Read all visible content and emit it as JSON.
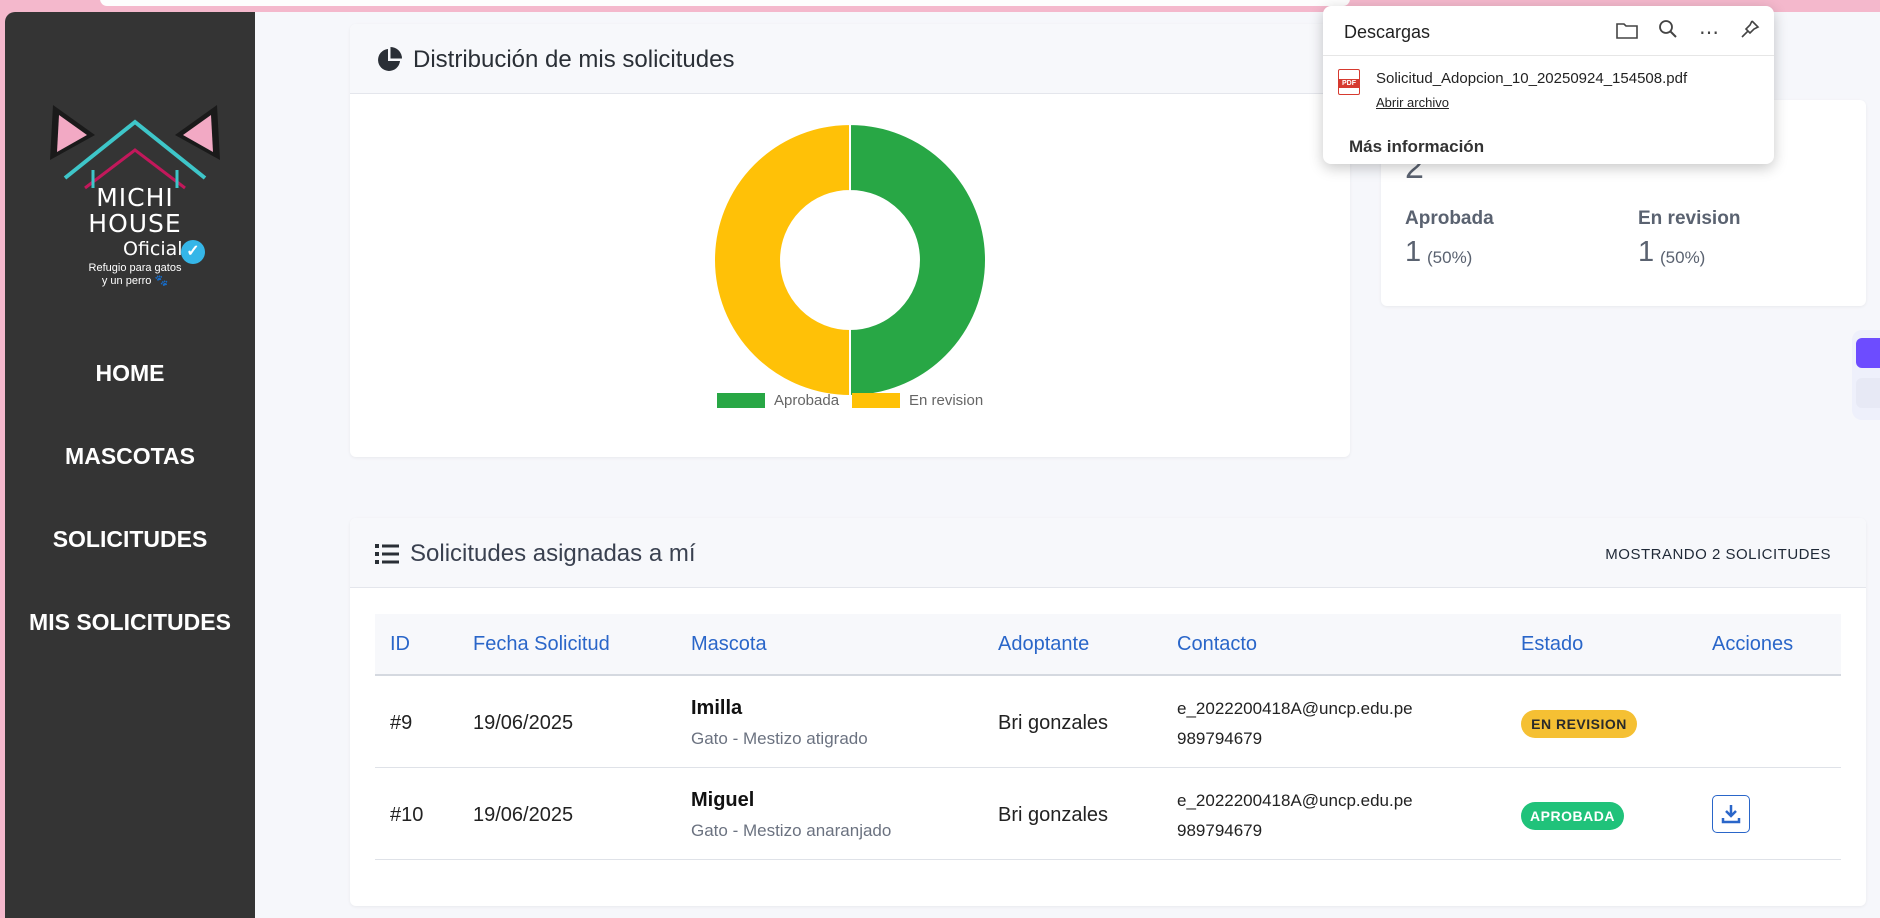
{
  "sidebar": {
    "logo": {
      "line1": "MICHI",
      "line2": "HOUSE",
      "oficial": "Oficial",
      "tagline1": "Refugio para gatos",
      "tagline2": "y un perro 🐾"
    },
    "nav": [
      "HOME",
      "MASCOTAS",
      "SOLICITUDES",
      "MIS SOLICITUDES"
    ]
  },
  "distribution": {
    "title": "Distribución de mis solicitudes"
  },
  "chart_data": {
    "type": "pie",
    "donut": true,
    "categories": [
      "Aprobada",
      "En revision"
    ],
    "values": [
      1,
      1
    ],
    "colors": [
      "#28a745",
      "#ffc107"
    ],
    "legend": "bottom"
  },
  "stats": {
    "total_value": "2",
    "items": [
      {
        "label": "Aprobada",
        "value": "1",
        "pct": "(50%)"
      },
      {
        "label": "En revision",
        "value": "1",
        "pct": "(50%)"
      }
    ]
  },
  "assigned": {
    "title": "Solicitudes asignadas a mí",
    "count_label": "MOSTRANDO 2 SOLICITUDES",
    "headers": [
      "ID",
      "Fecha Solicitud",
      "Mascota",
      "Adoptante",
      "Contacto",
      "Estado",
      "Acciones"
    ],
    "rows": [
      {
        "id": "#9",
        "fecha": "19/06/2025",
        "mascota": "Imilla",
        "detalle": "Gato - Mestizo atigrado",
        "adoptante": "Bri gonzales",
        "email": "e_2022200418A@uncp.edu.pe",
        "telefono": "989794679",
        "estado": "EN REVISION",
        "estado_color": "#f5c033"
      },
      {
        "id": "#10",
        "fecha": "19/06/2025",
        "mascota": "Miguel",
        "detalle": "Gato - Mestizo anaranjado",
        "adoptante": "Bri gonzales",
        "email": "e_2022200418A@uncp.edu.pe",
        "telefono": "989794679",
        "estado": "APROBADA",
        "estado_color": "#20c27a"
      }
    ]
  },
  "downloads": {
    "title": "Descargas",
    "file_name": "Solicitud_Adopcion_10_20250924_154508.pdf",
    "open_label": "Abrir archivo",
    "more_label": "Más información",
    "pdf_label": "PDF"
  },
  "colors": {
    "sidebar": "#343434",
    "accent_blue": "#2a66c9",
    "approved": "#28a745",
    "review": "#ffc107"
  }
}
